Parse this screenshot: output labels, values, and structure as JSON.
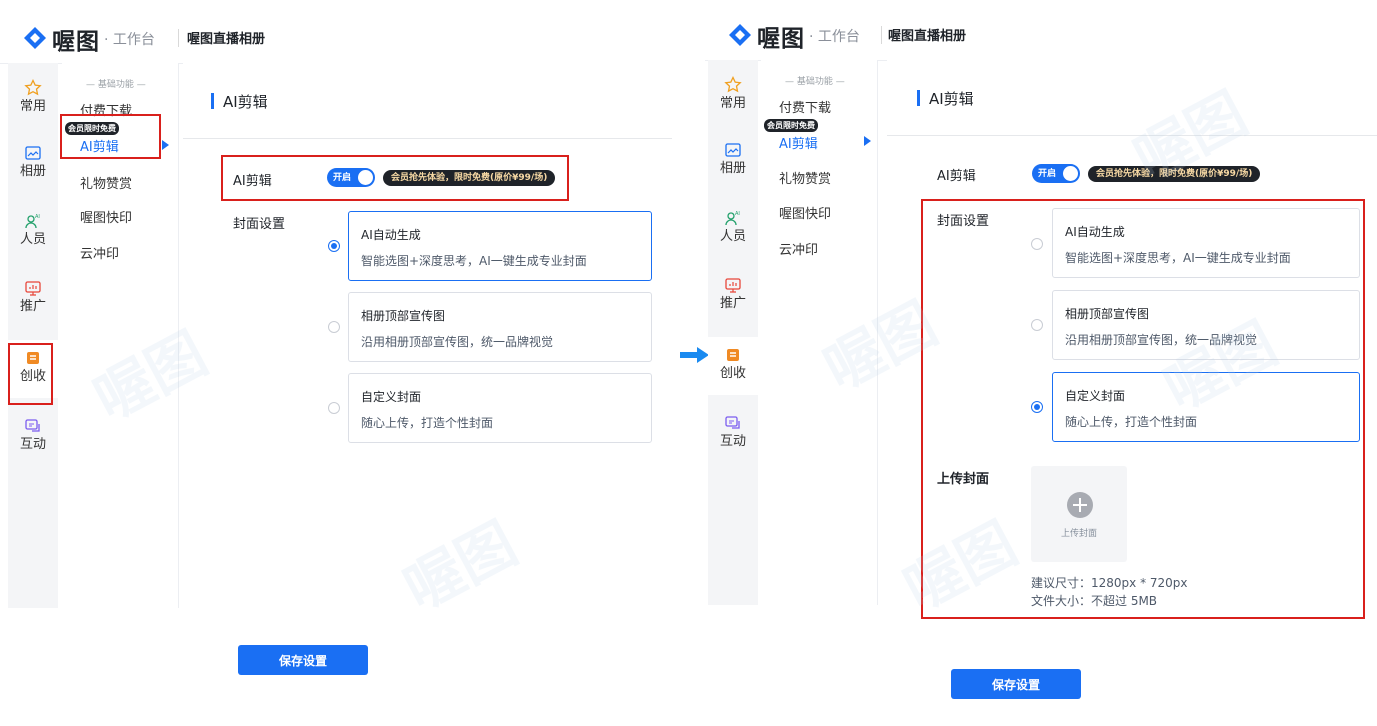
{
  "header": {
    "brand": "喔图",
    "workspace": "· 工作台",
    "album_title": "喔图直播相册"
  },
  "left_nav": {
    "items": [
      {
        "label": "常用",
        "icon": "star-icon"
      },
      {
        "label": "相册",
        "icon": "album-icon"
      },
      {
        "label": "人员",
        "icon": "people-ai-icon"
      },
      {
        "label": "推广",
        "icon": "promote-icon"
      },
      {
        "label": "创收",
        "icon": "revenue-icon"
      },
      {
        "label": "互动",
        "icon": "interact-icon"
      }
    ],
    "active_index": 4
  },
  "sub_nav": {
    "section_header": "— 基础功能 —",
    "items": [
      "付费下载",
      "AI剪辑",
      "礼物赞赏",
      "喔图快印",
      "云冲印"
    ],
    "active_item": "AI剪辑",
    "vip_badge": "会员限时免费"
  },
  "main": {
    "page_title": "AI剪辑",
    "ai_edit_label": "AI剪辑",
    "toggle_label": "开启",
    "toggle_on": true,
    "promo_text": "会员抢先体验，限时免费(原价¥99/场)",
    "cover_settings_label": "封面设置",
    "cover_options": [
      {
        "title": "AI自动生成",
        "desc": "智能选图+深度思考，AI一键生成专业封面"
      },
      {
        "title": "相册顶部宣传图",
        "desc": "沿用相册顶部宣传图，统一品牌视觉"
      },
      {
        "title": "自定义封面",
        "desc": "随心上传，打造个性封面"
      }
    ],
    "upload": {
      "label": "上传封面",
      "box_text": "上传封面",
      "size_hint": "建议尺寸：1280px * 720px",
      "file_hint": "文件大小：不超过 5MB"
    },
    "save_label": "保存设置"
  },
  "panels": {
    "before": {
      "selected_option": 0
    },
    "after": {
      "selected_option": 2
    }
  },
  "colors": {
    "accent": "#1a6ff3",
    "annotation": "#d9201c",
    "dark_badge": "#1f2329",
    "promo_text": "#f7d9a4"
  },
  "watermark": "喔图"
}
